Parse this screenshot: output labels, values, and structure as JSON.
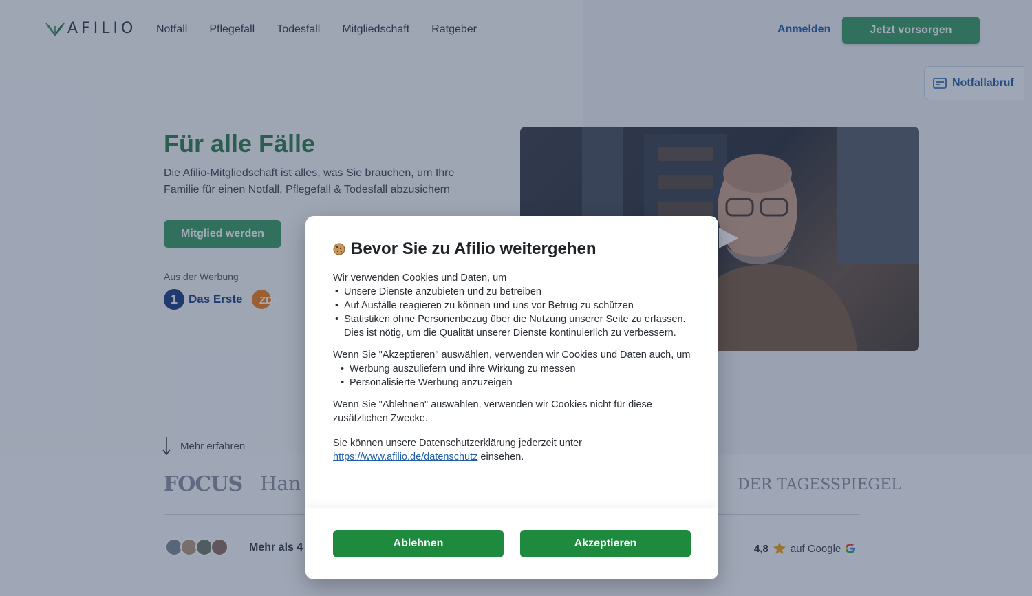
{
  "header": {
    "logo_text": "AFILIO",
    "nav": [
      "Notfall",
      "Pflegefall",
      "Todesfall",
      "Mitgliedschaft",
      "Ratgeber"
    ],
    "login_label": "Anmelden",
    "cta_label": "Jetzt vorsorgen"
  },
  "notfallabruf": {
    "label": "Notfallabruf"
  },
  "hero": {
    "title": "Für alle Fälle",
    "subtitle": "Die Afilio-Mitgliedschaft ist alles, was Sie brauchen, um Ihre Familie für einen Notfall, Pflegefall & Todesfall abzusichern",
    "member_button": "Mitglied werden",
    "ads_label": "Aus der Werbung",
    "das_erste_label": "Das Erste",
    "zdf_label": "ZDF"
  },
  "more_label": "Mehr erfahren",
  "press": {
    "focus": "FOCUS",
    "handelsblatt": "Han",
    "tagesspiegel": "DER TAGESSPIEGEL"
  },
  "social": {
    "members_text": "Mehr als 4",
    "rating_value": "4,8",
    "rating_source": "auf Google"
  },
  "modal": {
    "title": "Bevor Sie zu Afilio weitergehen",
    "intro": "Wir verwenden Cookies und Daten, um",
    "purposes": [
      "Unsere Dienste anzubieten und zu betreiben",
      "Auf Ausfälle reagieren zu können und uns vor Betrug zu schützen",
      "Statistiken ohne Personenbezug über die Nutzung unserer Seite zu erfassen. Dies ist nötig, um die Qualität unserer Dienste kontinuierlich zu verbessern."
    ],
    "accept_intro": "Wenn Sie \"Akzeptieren\" auswählen, verwenden wir Cookies und Daten auch, um",
    "accept_purposes": [
      "Werbung auszuliefern und ihre Wirkung zu messen",
      "Personalisierte Werbung anzuzeigen"
    ],
    "decline_text": "Wenn Sie \"Ablehnen\" auswählen, verwenden wir Cookies nicht für diese zusätzlichen Zwecke.",
    "privacy_prefix": "Sie können unsere Datenschutzerklärung jederzeit unter ",
    "privacy_link": "https://www.afilio.de/datenschutz",
    "privacy_suffix": " einsehen.",
    "decline_button": "Ablehnen",
    "accept_button": "Akzeptieren"
  },
  "colors": {
    "brand_green": "#3b9c66",
    "modal_button_green": "#1e8a3e",
    "link_blue": "#1f5fa8",
    "overlay": "rgba(37,52,84,0.42)"
  }
}
